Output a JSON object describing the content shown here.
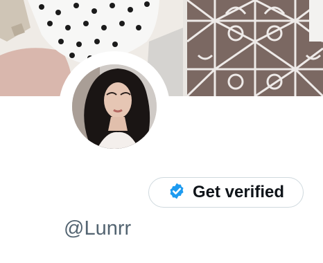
{
  "profile": {
    "handle": "@Lunrr",
    "verify_button_label": "Get verified",
    "verify_icon": "verified-badge-icon"
  },
  "colors": {
    "verified_badge": "#1d9bf0",
    "handle_text": "#536471",
    "button_border": "#cfd9de"
  }
}
